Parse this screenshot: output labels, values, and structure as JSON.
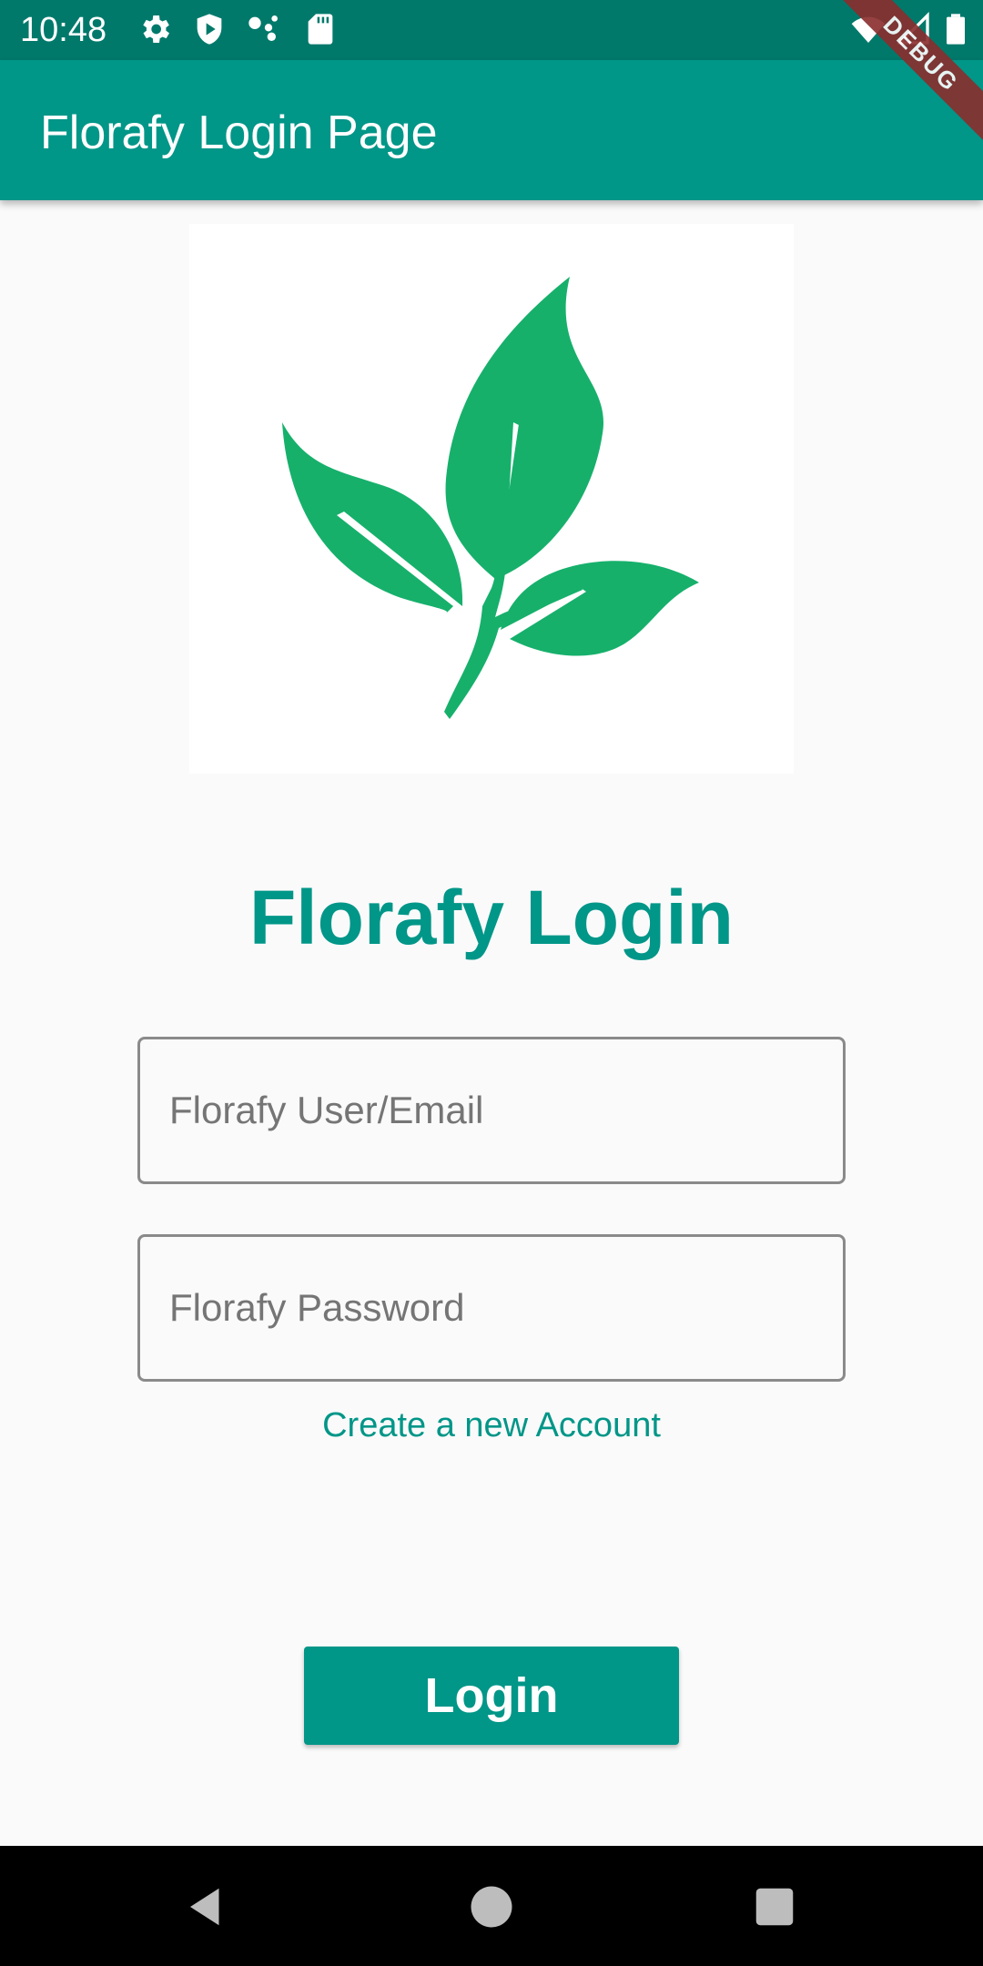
{
  "status_bar": {
    "time": "10:48",
    "icons": [
      "gear-icon",
      "shield-play-icon",
      "assistant-dots-icon",
      "sd-card-icon",
      "wifi-icon",
      "cell-signal-icon",
      "battery-icon"
    ]
  },
  "debug_banner": "DEBUG",
  "app_bar": {
    "title": "Florafy Login Page"
  },
  "logo": {
    "icon": "leaf-branch-icon",
    "color": "#16B06B"
  },
  "heading": "Florafy Login",
  "form": {
    "user_placeholder": "Florafy User/Email",
    "password_placeholder": "Florafy Password",
    "create_account_link": "Create a new Account",
    "login_button": "Login"
  },
  "nav_bar": {
    "buttons": [
      "back-icon",
      "home-icon",
      "recents-icon"
    ]
  },
  "colors": {
    "primary": "#009688",
    "status_bar": "#00796B",
    "background": "#FAFAFA",
    "debug": "#8B2D2D"
  }
}
